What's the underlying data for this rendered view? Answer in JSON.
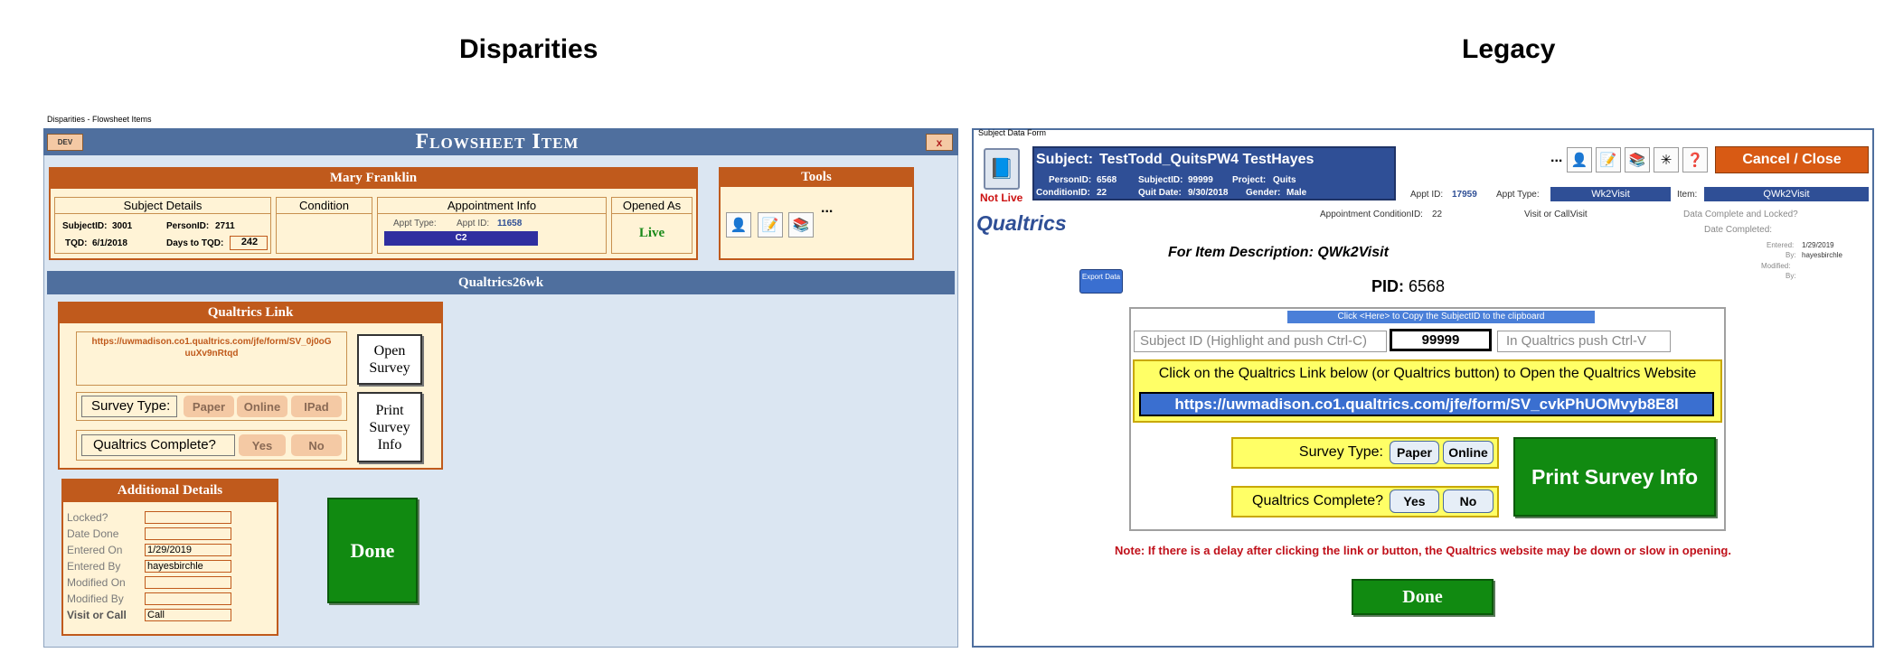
{
  "titles": {
    "left": "Disparities",
    "right": "Legacy"
  },
  "left": {
    "window_caption": "Disparities - Flowsheet Items",
    "dev_label": "DEV",
    "close_label": "x",
    "form_title": "Flowsheet Item",
    "subject_name": "Mary Franklin",
    "tools_title": "Tools",
    "tools_more": "...",
    "subject_details_label": "Subject Details",
    "subject_id_label": "SubjectID:",
    "subject_id": "3001",
    "person_id_label": "PersonID:",
    "person_id": "2711",
    "tqd_label": "TQD:",
    "tqd": "6/1/2018",
    "days_to_tqd_label": "Days to TQD:",
    "days_to_tqd": "242",
    "condition_label": "Condition",
    "appt_info_label": "Appointment Info",
    "appt_type_label": "Appt Type:",
    "appt_id_label": "Appt ID:",
    "appt_id": "11658",
    "appt_type_value": "C2",
    "opened_as_label": "Opened As",
    "opened_as": "Live",
    "section_bar": "Qualtrics26wk",
    "qualtrics_link_title": "Qualtrics Link",
    "qualtrics_url": "https://uwmadison.co1.qualtrics.com/jfe/form/SV_0j0oG uuXv9nRtqd",
    "open_survey": "Open Survey",
    "print_survey": "Print Survey Info",
    "survey_type_label": "Survey Type:",
    "survey_types": [
      "Paper",
      "Online",
      "IPad"
    ],
    "complete_label": "Qualtrics Complete?",
    "complete_options": [
      "Yes",
      "No"
    ],
    "additional_title": "Additional Details",
    "additional_rows": [
      {
        "label": "Locked?",
        "value": ""
      },
      {
        "label": "Date Done",
        "value": ""
      },
      {
        "label": "Entered On",
        "value": "1/29/2019"
      },
      {
        "label": "Entered By",
        "value": "hayesbirchle"
      },
      {
        "label": "Modified On",
        "value": ""
      },
      {
        "label": "Modified By",
        "value": ""
      },
      {
        "label": "Visit or Call",
        "value": "Call"
      }
    ],
    "done": "Done"
  },
  "right": {
    "window_caption": "Subject Data Form",
    "not_live": "Not Live",
    "subject_label": "Subject:",
    "subject_name": "TestTodd_QuitsPW4 TestHayes",
    "person_id_label": "PersonID:",
    "person_id": "6568",
    "subject_id_label": "SubjectID:",
    "subject_id": "99999",
    "project_label": "Project:",
    "project": "Quits",
    "condition_id_label": "ConditionID:",
    "condition_id": "22",
    "quit_date_label": "Quit Date:",
    "quit_date": "9/30/2018",
    "gender_label": "Gender:",
    "gender": "Male",
    "more": "...",
    "cancel_close": "Cancel / Close",
    "appt_id_label": "Appt ID:",
    "appt_id": "17959",
    "appt_type_label": "Appt Type:",
    "appt_type": "Wk2Visit",
    "item_label": "Item:",
    "item": "QWk2Visit",
    "heading": "Qualtrics",
    "appt_cond_label": "Appointment ConditionID:",
    "appt_cond": "22",
    "visit_or_call_label": "Visit or Call:",
    "visit_or_call": "Visit",
    "data_complete_label": "Data Complete and Locked?",
    "date_completed_label": "Date Completed:",
    "entered_label": "Entered:",
    "entered": "1/29/2019",
    "by_label": "By:",
    "entered_by": "hayesbirchle",
    "modified_label": "Modified:",
    "modified_by_label": "By:",
    "item_desc": "For Item Description: QWk2Visit",
    "export_data": "Export Data",
    "pid_label": "PID:",
    "pid": "6568",
    "copy_bar": "Click <Here> to Copy the SubjectID to the clipboard",
    "subject_id_hint": "Subject ID (Highlight and push Ctrl-C)",
    "subject_id_box": "99999",
    "paste_hint": "In Qualtrics push Ctrl-V",
    "click_link_text": "Click on the Qualtrics Link below (or Qualtrics button) to Open the Qualtrics Website",
    "qualtrics_url": "https://uwmadison.co1.qualtrics.com/jfe/form/SV_cvkPhUOMvyb8E8l",
    "survey_type_label": "Survey Type:",
    "survey_types": [
      "Paper",
      "Online"
    ],
    "complete_label": "Qualtrics Complete?",
    "complete_options": [
      "Yes",
      "No"
    ],
    "print_survey": "Print Survey Info",
    "note": "Note: If there is a delay after clicking the link or button, the Qualtrics website may be down or slow in opening.",
    "done": "Done"
  },
  "colors": {
    "orange": "#c05a1c",
    "steel_blue": "#4f6f9e",
    "green": "#118a11",
    "yellow": "#ffff66"
  }
}
